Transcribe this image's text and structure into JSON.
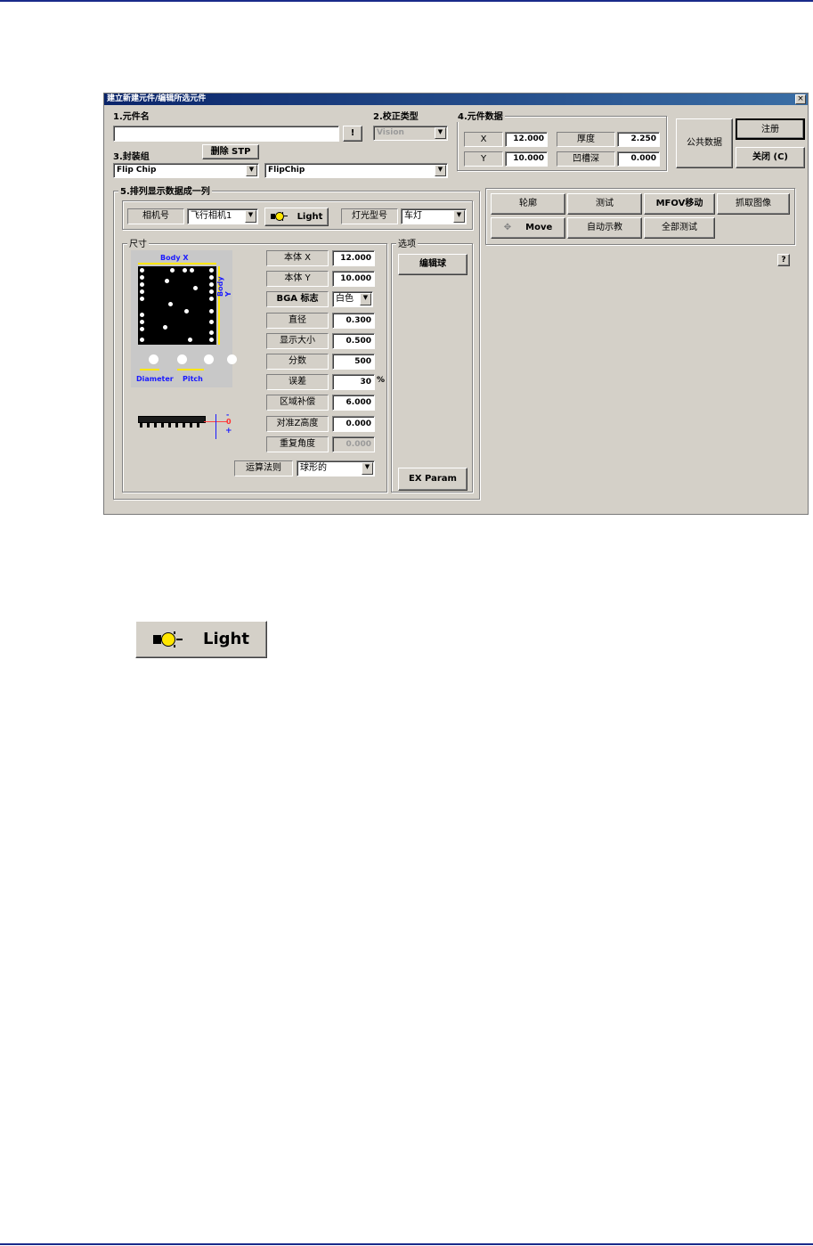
{
  "dialog": {
    "title": "建立新建元件/编辑所选元件",
    "close_glyph": "×",
    "sections": {
      "part_name": "1.元件名",
      "calib_type": "2.校正类型",
      "package_group": "3.封装组",
      "part_data": "4.元件数据",
      "sequence": "5.排列显示数据成一列"
    },
    "part_name_value": "",
    "bang_button": "!",
    "calib_type_value": "Vision",
    "delete_stp_button": "删除  STP",
    "package_combo_1": "Flip Chip",
    "package_combo_2": "FlipChip",
    "part_data": {
      "x_label": "X",
      "x_value": "12.000",
      "y_label": "Y",
      "y_value": "10.000",
      "thickness_label": "厚度",
      "thickness_value": "2.250",
      "pocket_depth_label": "凹槽深",
      "pocket_depth_value": "0.000"
    },
    "common_data_button": "公共数据",
    "register_button": "注册",
    "close_button": "关闭 (C)",
    "camera_label": "相机号",
    "camera_value": "飞行相机1",
    "light_button": "Light",
    "light_type_label": "灯光型号",
    "light_type_value": "车灯",
    "dimension_group": "尺寸",
    "diagram": {
      "body_x": "Body X",
      "body_y": "Body Y",
      "diameter": "Diameter",
      "pitch": "Pitch",
      "z_minus": "-",
      "z_zero": "0",
      "z_plus": "+"
    },
    "params": [
      {
        "label": "本体 X",
        "value": "12.000",
        "kind": "field"
      },
      {
        "label": "本体 Y",
        "value": "10.000",
        "kind": "field"
      },
      {
        "label": "BGA 标志",
        "value": "白色",
        "kind": "combo"
      },
      {
        "label": "直径",
        "value": "0.300",
        "kind": "field"
      },
      {
        "label": "显示大小",
        "value": "0.500",
        "kind": "field"
      },
      {
        "label": "分数",
        "value": "500",
        "kind": "field"
      },
      {
        "label": "误差",
        "value": "30",
        "kind": "field",
        "unit": "%"
      },
      {
        "label": "区域补偿",
        "value": "6.000",
        "kind": "field"
      },
      {
        "label": "对准Z高度",
        "value": "0.000",
        "kind": "field"
      },
      {
        "label": "重复角度",
        "value": "0.000",
        "kind": "disabled"
      }
    ],
    "algorithm_label": "运算法则",
    "algorithm_value": "球形的",
    "options_group": "选项",
    "edit_ball_button": "编辑球",
    "ex_param_button": "EX Param",
    "actions": {
      "outline": "轮廓",
      "test": "测试",
      "mfov_move": "MFOV移动",
      "capture": "抓取图像",
      "move": "Move",
      "auto_teach": "自动示教",
      "test_all": "全部测试"
    },
    "help_glyph": "?"
  },
  "enlarged_light_button": "Light",
  "colors": {
    "dialog_bg": "#d4d0c8",
    "title_start": "#0a246a",
    "title_end": "#3a6ea5",
    "diagram_label_blue": "#1a1aff",
    "diagram_arrow_yellow": "#ffe600",
    "bulb_yellow": "#ffe600",
    "page_rule": "#1a2a8a"
  }
}
